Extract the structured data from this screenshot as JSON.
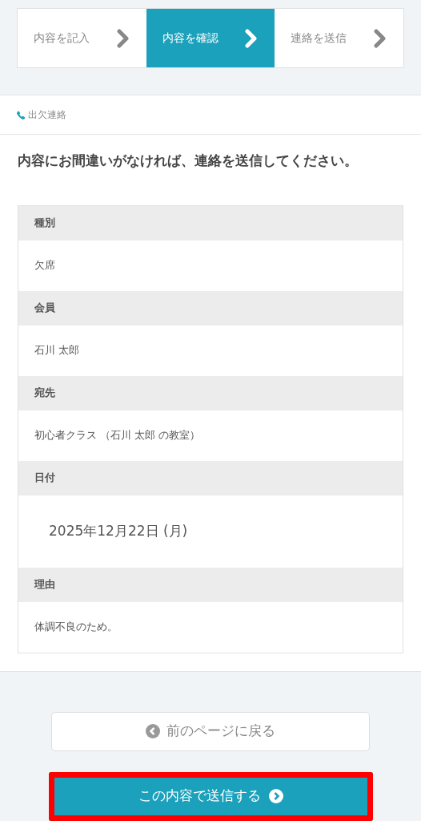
{
  "steps": [
    {
      "label": "内容を記入",
      "selected": false
    },
    {
      "label": "内容を確認",
      "selected": true
    },
    {
      "label": "連絡を送信",
      "selected": false
    }
  ],
  "card": {
    "header": "出欠連絡",
    "message": "内容にお間違いがなければ、連絡を送信してください。",
    "fields": [
      {
        "label": "種別",
        "value": "欠席",
        "kind": "text"
      },
      {
        "label": "会員",
        "value": "石川 太郎",
        "kind": "text"
      },
      {
        "label": "宛先",
        "value": "初心者クラス （石川 太郎 の教室）",
        "kind": "text"
      },
      {
        "label": "日付",
        "value": "2025年12月22日 (月)",
        "kind": "date"
      },
      {
        "label": "理由",
        "value": "体調不良のため。",
        "kind": "text"
      }
    ]
  },
  "buttons": {
    "back": "前のページに戻る",
    "submit": "この内容で送信する",
    "submit_highlighted": true
  }
}
